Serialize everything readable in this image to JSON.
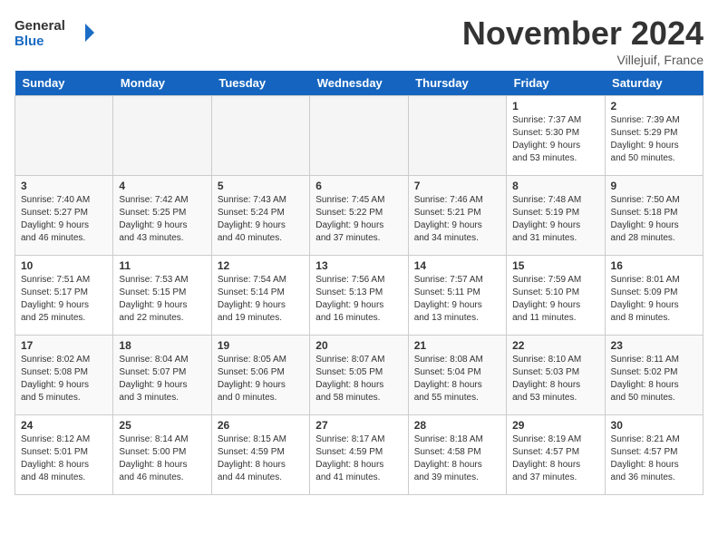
{
  "header": {
    "logo_general": "General",
    "logo_blue": "Blue",
    "month_title": "November 2024",
    "location": "Villejuif, France"
  },
  "weekdays": [
    "Sunday",
    "Monday",
    "Tuesday",
    "Wednesday",
    "Thursday",
    "Friday",
    "Saturday"
  ],
  "weeks": [
    [
      {
        "day": "",
        "info": ""
      },
      {
        "day": "",
        "info": ""
      },
      {
        "day": "",
        "info": ""
      },
      {
        "day": "",
        "info": ""
      },
      {
        "day": "",
        "info": ""
      },
      {
        "day": "1",
        "info": "Sunrise: 7:37 AM\nSunset: 5:30 PM\nDaylight: 9 hours\nand 53 minutes."
      },
      {
        "day": "2",
        "info": "Sunrise: 7:39 AM\nSunset: 5:29 PM\nDaylight: 9 hours\nand 50 minutes."
      }
    ],
    [
      {
        "day": "3",
        "info": "Sunrise: 7:40 AM\nSunset: 5:27 PM\nDaylight: 9 hours\nand 46 minutes."
      },
      {
        "day": "4",
        "info": "Sunrise: 7:42 AM\nSunset: 5:25 PM\nDaylight: 9 hours\nand 43 minutes."
      },
      {
        "day": "5",
        "info": "Sunrise: 7:43 AM\nSunset: 5:24 PM\nDaylight: 9 hours\nand 40 minutes."
      },
      {
        "day": "6",
        "info": "Sunrise: 7:45 AM\nSunset: 5:22 PM\nDaylight: 9 hours\nand 37 minutes."
      },
      {
        "day": "7",
        "info": "Sunrise: 7:46 AM\nSunset: 5:21 PM\nDaylight: 9 hours\nand 34 minutes."
      },
      {
        "day": "8",
        "info": "Sunrise: 7:48 AM\nSunset: 5:19 PM\nDaylight: 9 hours\nand 31 minutes."
      },
      {
        "day": "9",
        "info": "Sunrise: 7:50 AM\nSunset: 5:18 PM\nDaylight: 9 hours\nand 28 minutes."
      }
    ],
    [
      {
        "day": "10",
        "info": "Sunrise: 7:51 AM\nSunset: 5:17 PM\nDaylight: 9 hours\nand 25 minutes."
      },
      {
        "day": "11",
        "info": "Sunrise: 7:53 AM\nSunset: 5:15 PM\nDaylight: 9 hours\nand 22 minutes."
      },
      {
        "day": "12",
        "info": "Sunrise: 7:54 AM\nSunset: 5:14 PM\nDaylight: 9 hours\nand 19 minutes."
      },
      {
        "day": "13",
        "info": "Sunrise: 7:56 AM\nSunset: 5:13 PM\nDaylight: 9 hours\nand 16 minutes."
      },
      {
        "day": "14",
        "info": "Sunrise: 7:57 AM\nSunset: 5:11 PM\nDaylight: 9 hours\nand 13 minutes."
      },
      {
        "day": "15",
        "info": "Sunrise: 7:59 AM\nSunset: 5:10 PM\nDaylight: 9 hours\nand 11 minutes."
      },
      {
        "day": "16",
        "info": "Sunrise: 8:01 AM\nSunset: 5:09 PM\nDaylight: 9 hours\nand 8 minutes."
      }
    ],
    [
      {
        "day": "17",
        "info": "Sunrise: 8:02 AM\nSunset: 5:08 PM\nDaylight: 9 hours\nand 5 minutes."
      },
      {
        "day": "18",
        "info": "Sunrise: 8:04 AM\nSunset: 5:07 PM\nDaylight: 9 hours\nand 3 minutes."
      },
      {
        "day": "19",
        "info": "Sunrise: 8:05 AM\nSunset: 5:06 PM\nDaylight: 9 hours\nand 0 minutes."
      },
      {
        "day": "20",
        "info": "Sunrise: 8:07 AM\nSunset: 5:05 PM\nDaylight: 8 hours\nand 58 minutes."
      },
      {
        "day": "21",
        "info": "Sunrise: 8:08 AM\nSunset: 5:04 PM\nDaylight: 8 hours\nand 55 minutes."
      },
      {
        "day": "22",
        "info": "Sunrise: 8:10 AM\nSunset: 5:03 PM\nDaylight: 8 hours\nand 53 minutes."
      },
      {
        "day": "23",
        "info": "Sunrise: 8:11 AM\nSunset: 5:02 PM\nDaylight: 8 hours\nand 50 minutes."
      }
    ],
    [
      {
        "day": "24",
        "info": "Sunrise: 8:12 AM\nSunset: 5:01 PM\nDaylight: 8 hours\nand 48 minutes."
      },
      {
        "day": "25",
        "info": "Sunrise: 8:14 AM\nSunset: 5:00 PM\nDaylight: 8 hours\nand 46 minutes."
      },
      {
        "day": "26",
        "info": "Sunrise: 8:15 AM\nSunset: 4:59 PM\nDaylight: 8 hours\nand 44 minutes."
      },
      {
        "day": "27",
        "info": "Sunrise: 8:17 AM\nSunset: 4:59 PM\nDaylight: 8 hours\nand 41 minutes."
      },
      {
        "day": "28",
        "info": "Sunrise: 8:18 AM\nSunset: 4:58 PM\nDaylight: 8 hours\nand 39 minutes."
      },
      {
        "day": "29",
        "info": "Sunrise: 8:19 AM\nSunset: 4:57 PM\nDaylight: 8 hours\nand 37 minutes."
      },
      {
        "day": "30",
        "info": "Sunrise: 8:21 AM\nSunset: 4:57 PM\nDaylight: 8 hours\nand 36 minutes."
      }
    ]
  ]
}
